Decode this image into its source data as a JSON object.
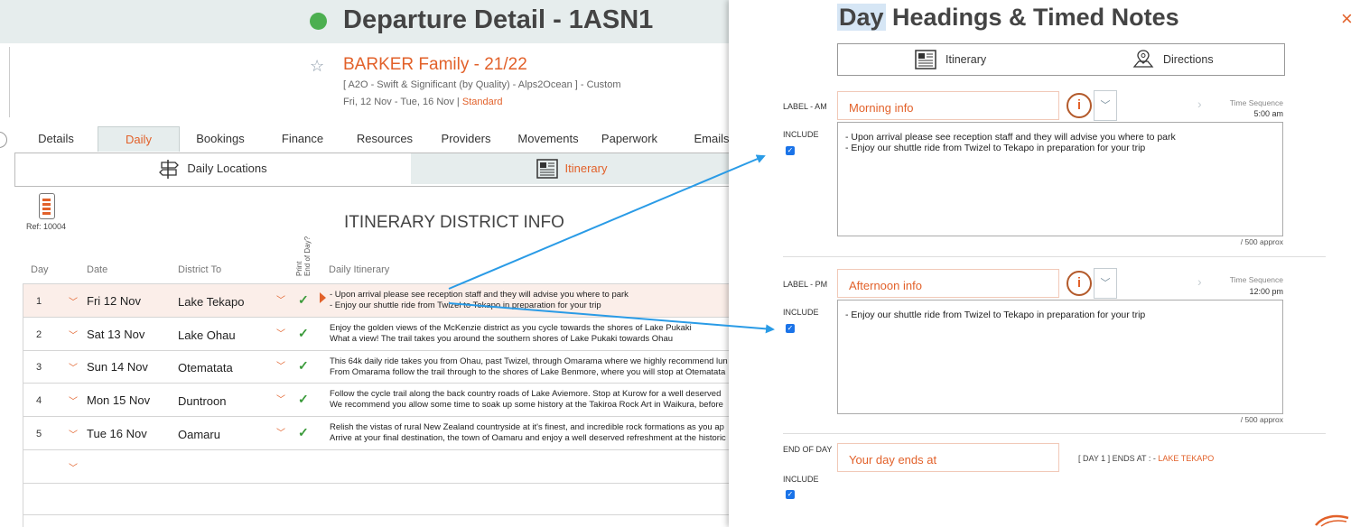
{
  "header": {
    "title": "Departure Detail - 1ASN1"
  },
  "booking": {
    "family": "BARKER Family - 21/22",
    "product": "[ A2O - Swift & Significant (by Quality) - Alps2Ocean ] - Custom",
    "dates": "Fri, 12 Nov  - Tue, 16 Nov  |",
    "standard": "Standard"
  },
  "tabs": [
    "Details",
    "Daily",
    "Bookings",
    "Finance",
    "Resources",
    "Providers",
    "Movements",
    "Paperwork",
    "Emails"
  ],
  "active_tab": "Daily",
  "subtabs": {
    "daily_locations": "Daily Locations",
    "itinerary": "Itinerary"
  },
  "ref": "Ref: 10004",
  "district_title": "ITINERARY DISTRICT INFO",
  "table": {
    "headers": {
      "day": "Day",
      "date": "Date",
      "district": "District To",
      "print": "Print",
      "end_of_day": "End of Day?",
      "itinerary": "Daily Itinerary"
    },
    "rows": [
      {
        "day": "1",
        "date": "Fri 12 Nov",
        "district": "Lake Tekapo",
        "line1": "- Upon arrival please see reception staff and they will advise you where to park",
        "line2": "- Enjoy our shuttle ride from Twizel to Tekapo in preparation for your trip"
      },
      {
        "day": "2",
        "date": "Sat 13 Nov",
        "district": "Lake Ohau",
        "line1": "Enjoy the golden views of the McKenzie district as you cycle towards the shores of Lake Pukaki",
        "line2": "What a view!  The trail takes you around the southern shores of Lake Pukaki towards Ohau"
      },
      {
        "day": "3",
        "date": "Sun 14 Nov",
        "district": "Otematata",
        "line1": "This 64k daily ride takes you from Ohau, past Twizel, through Omarama where we highly recommend lun",
        "line2": "From Omarama follow the trail through to the shores of Lake Benmore, where you will stop at Otematata"
      },
      {
        "day": "4",
        "date": "Mon 15 Nov",
        "district": "Duntroon",
        "line1": "Follow the cycle trail along the back country roads of Lake Aviemore.  Stop at Kurow for a well deserved",
        "line2": "We recommend you allow some time to soak up some history at the Takiroa Rock Art in Waikura, before"
      },
      {
        "day": "5",
        "date": "Tue 16 Nov",
        "district": "Oamaru",
        "line1": "Relish the vistas of rural New Zealand countryside at it's finest, and incredible rock formations as you ap",
        "line2": "Arrive at your final destination, the town of Oamaru and enjoy a well deserved refreshment at the historic"
      }
    ]
  },
  "panel": {
    "title_highlight": "Day",
    "title_rest": " Headings & Timed Notes",
    "close": "×",
    "toggle": {
      "itinerary": "Itinerary",
      "directions": "Directions"
    },
    "am": {
      "label": "LABEL - AM",
      "include": "INCLUDE",
      "value": "Morning info",
      "ts_label": "Time Sequence",
      "ts_value": "5:00 am",
      "text": "- Upon arrival please see reception staff and they will advise you where to park\n- Enjoy our shuttle ride from Twizel to Tekapo in preparation for your trip",
      "approx": "/ 500 approx"
    },
    "pm": {
      "label": "LABEL - PM",
      "include": "INCLUDE",
      "value": "Afternoon info",
      "ts_label": "Time Sequence",
      "ts_value": "12:00 pm",
      "text": "- Enjoy our shuttle ride from Twizel to Tekapo in preparation for your trip",
      "approx": "/ 500 approx"
    },
    "eod": {
      "label": "END OF DAY",
      "include": "INCLUDE",
      "value": "Your day ends at",
      "ends_prefix": "[ DAY 1 ] ENDS AT : -",
      "ends_place": "LAKE TEKAPO"
    }
  },
  "colors": {
    "accent": "#e2612a",
    "arrow": "#2a9be6",
    "header_bg": "#e6eded",
    "check": "#3a9a3a"
  }
}
